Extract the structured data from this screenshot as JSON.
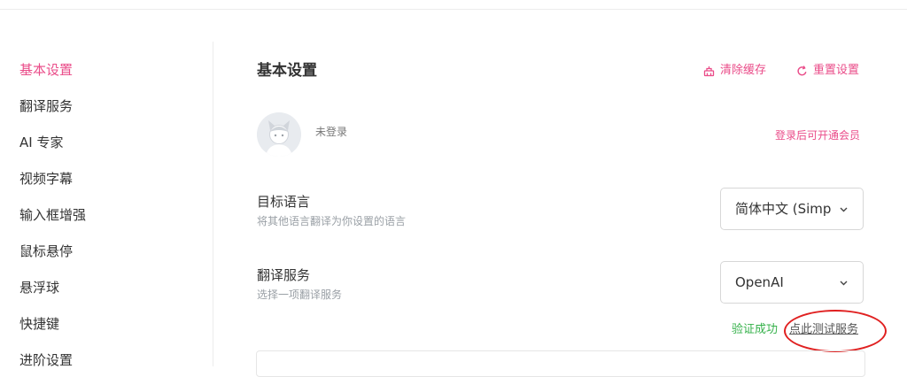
{
  "sidebar": {
    "items": [
      {
        "label": "基本设置",
        "active": true
      },
      {
        "label": "翻译服务"
      },
      {
        "label": "AI 专家"
      },
      {
        "label": "视频字幕"
      },
      {
        "label": "输入框增强"
      },
      {
        "label": "鼠标悬停"
      },
      {
        "label": "悬浮球"
      },
      {
        "label": "快捷键"
      },
      {
        "label": "进阶设置"
      }
    ]
  },
  "header": {
    "title": "基本设置",
    "clear_cache_label": "清除缓存",
    "reset_settings_label": "重置设置"
  },
  "account": {
    "status": "未登录",
    "member_link": "登录后可开通会员"
  },
  "settings": {
    "target_language": {
      "title": "目标语言",
      "description": "将其他语言翻译为你设置的语言",
      "value": "简体中文 (Simplified Chinese)"
    },
    "translation_service": {
      "title": "翻译服务",
      "description": "选择一项翻译服务",
      "value": "OpenAI",
      "verify_status": "验证成功",
      "test_link": "点此测试服务"
    }
  },
  "colors": {
    "accent": "#ea4c89",
    "success": "#35b14a",
    "annotation": "#e02020"
  },
  "icons": {
    "clear_cache": "broom-icon",
    "reset": "refresh-icon",
    "chevron": "chevron-down-icon"
  }
}
